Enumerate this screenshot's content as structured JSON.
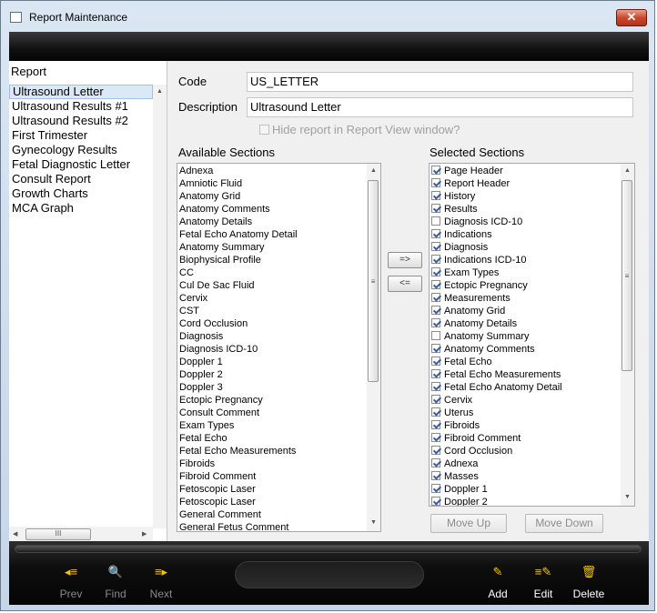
{
  "window": {
    "title": "Report Maintenance",
    "close_glyph": "✕"
  },
  "left": {
    "header": "Report",
    "items": [
      "Ultrasound Letter",
      "Ultrasound Results #1",
      "Ultrasound Results #2",
      "First Trimester",
      "Gynecology Results",
      "Fetal Diagnostic Letter",
      "Consult Report",
      "Growth Charts",
      "MCA Graph"
    ],
    "selected_index": 0
  },
  "form": {
    "code_label": "Code",
    "code_value": "US_LETTER",
    "description_label": "Description",
    "description_value": "Ultrasound Letter",
    "hide_label": "Hide report in Report View window?"
  },
  "available": {
    "title": "Available Sections",
    "items": [
      "Adnexa",
      "Amniotic Fluid",
      "Anatomy Grid",
      "Anatomy Comments",
      "Anatomy Details",
      "Fetal Echo Anatomy Detail",
      "Anatomy Summary",
      "Biophysical Profile",
      "CC",
      "Cul De Sac Fluid",
      "Cervix",
      "CST",
      "Cord Occlusion",
      "Diagnosis",
      "Diagnosis ICD-10",
      "Doppler 1",
      "Doppler 2",
      "Doppler 3",
      "Ectopic Pregnancy",
      "Consult Comment",
      "Exam Types",
      "Fetal Echo",
      "Fetal Echo Measurements",
      "Fibroids",
      "Fibroid Comment",
      "Fetoscopic Laser",
      "Fetoscopic Laser",
      "General Comment",
      "General Fetus Comment"
    ]
  },
  "selected": {
    "title": "Selected Sections",
    "items": [
      {
        "label": "Page Header",
        "checked": true
      },
      {
        "label": "Report Header",
        "checked": true
      },
      {
        "label": "History",
        "checked": true
      },
      {
        "label": "Results",
        "checked": true
      },
      {
        "label": "Diagnosis ICD-10",
        "checked": false
      },
      {
        "label": "Indications",
        "checked": true
      },
      {
        "label": "Diagnosis",
        "checked": true
      },
      {
        "label": "Indications ICD-10",
        "checked": true
      },
      {
        "label": "Exam Types",
        "checked": true
      },
      {
        "label": "Ectopic Pregnancy",
        "checked": true
      },
      {
        "label": "Measurements",
        "checked": true
      },
      {
        "label": "Anatomy Grid",
        "checked": true
      },
      {
        "label": "Anatomy Details",
        "checked": true
      },
      {
        "label": "Anatomy Summary",
        "checked": false
      },
      {
        "label": "Anatomy Comments",
        "checked": true
      },
      {
        "label": "Fetal Echo",
        "checked": true
      },
      {
        "label": "Fetal Echo Measurements",
        "checked": true
      },
      {
        "label": "Fetal Echo Anatomy Detail",
        "checked": true
      },
      {
        "label": "Cervix",
        "checked": true
      },
      {
        "label": "Uterus",
        "checked": true
      },
      {
        "label": "Fibroids",
        "checked": true
      },
      {
        "label": "Fibroid Comment",
        "checked": true
      },
      {
        "label": "Cord Occlusion",
        "checked": true
      },
      {
        "label": "Adnexa",
        "checked": true
      },
      {
        "label": "Masses",
        "checked": true
      },
      {
        "label": "Doppler 1",
        "checked": true
      },
      {
        "label": "Doppler 2",
        "checked": true
      }
    ]
  },
  "move": {
    "add_label": "=>",
    "remove_label": "<="
  },
  "order": {
    "up_label": "Move Up",
    "down_label": "Move Down"
  },
  "toolbar": {
    "prev": "Prev",
    "find": "Find",
    "next": "Next",
    "add": "Add",
    "edit": "Edit",
    "delete": "Delete"
  },
  "scroll": {
    "up": "▲",
    "down": "▼",
    "left": "◀",
    "right": "▶",
    "grip_v": "≡",
    "grip_h": "III"
  },
  "colors": {
    "accent_icon": "#f2c400",
    "toolbar_bg": "#0e0e0e",
    "selection": "#dde8f6"
  }
}
